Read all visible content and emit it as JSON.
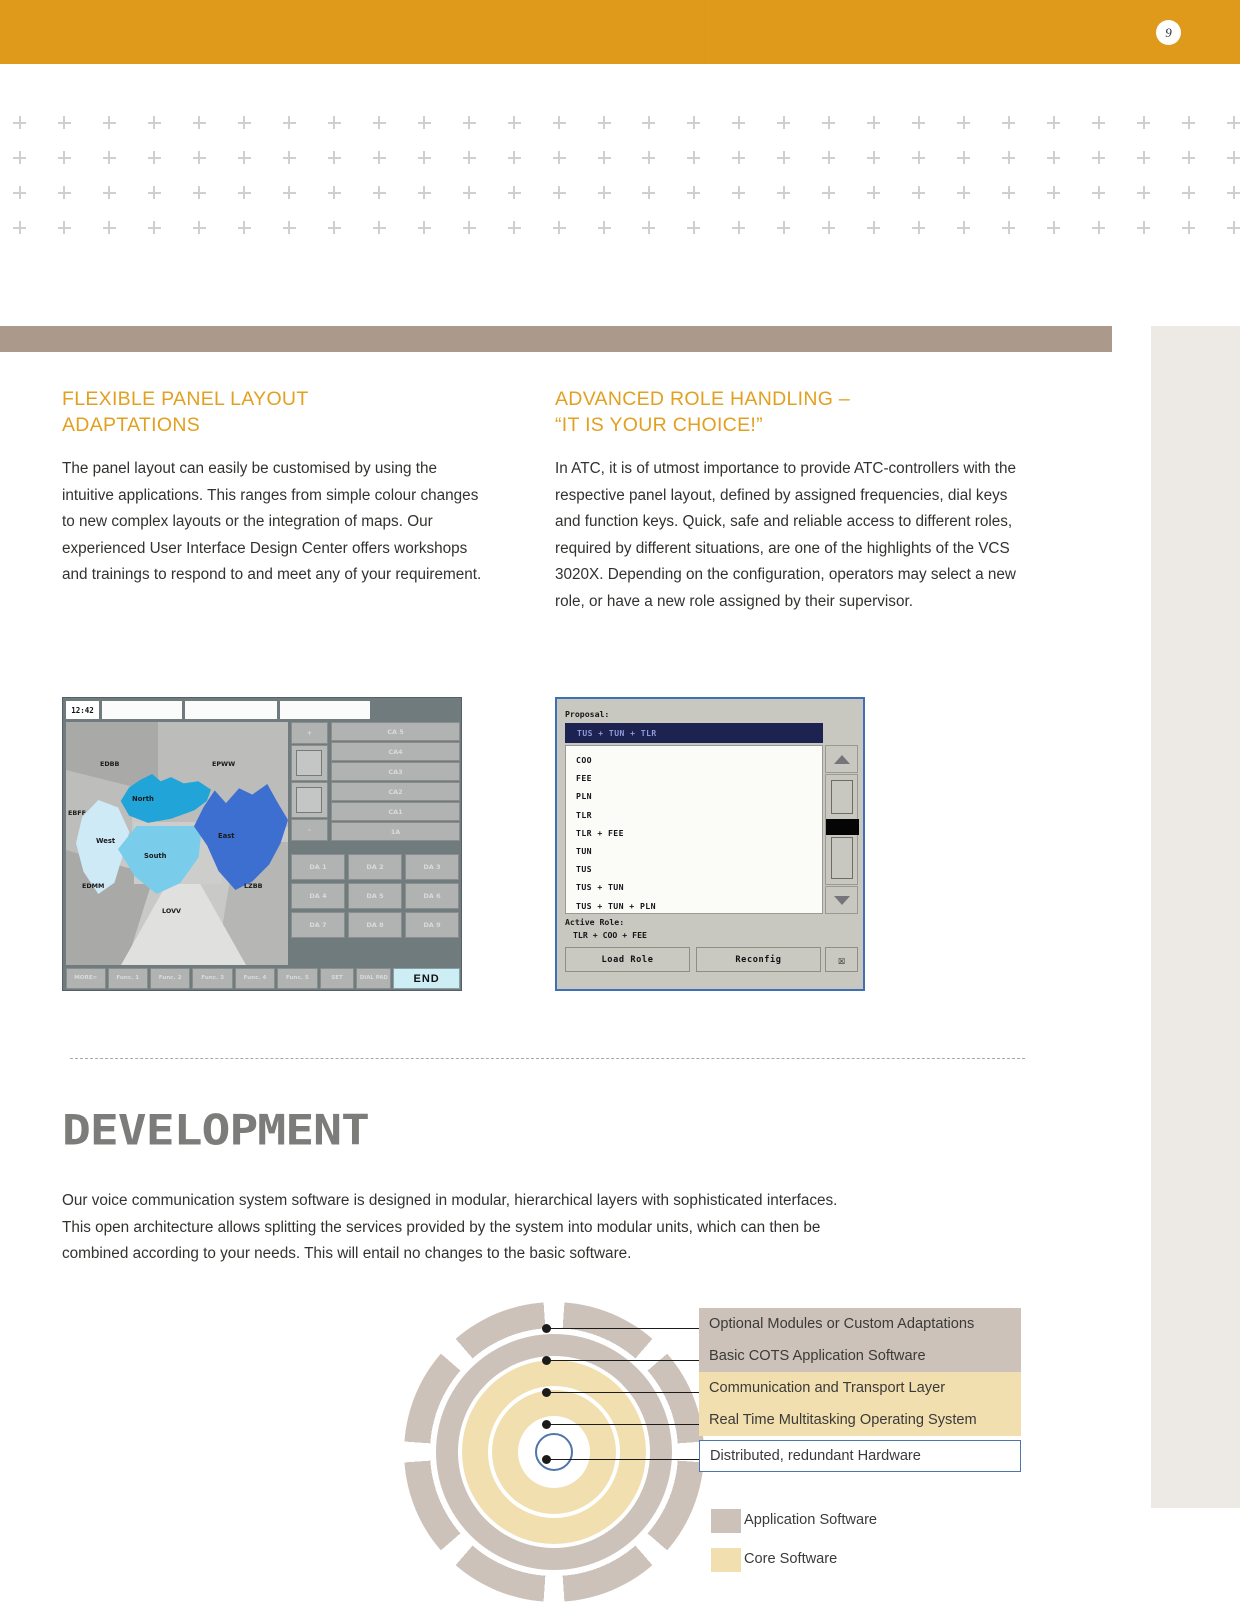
{
  "page": {
    "number": "9",
    "header_color": "#df9a1b",
    "accent_color": "#e2a020",
    "taupe_color": "#ab9a8b"
  },
  "columns": {
    "left": {
      "title": "FLEXIBLE PANEL LAYOUT\nADAPTATIONS",
      "body": "The panel layout can easily be customised by using the intuitive applications. This ranges from simple colour changes to new complex layouts or the integration of maps. Our experienced User Interface Design Center offers workshops and trainings to respond to and meet any of your requirement."
    },
    "right": {
      "title": "ADVANCED ROLE HANDLING –\n“IT IS YOUR CHOICE!”",
      "body": "In ATC, it is of utmost importance to provide ATC-controllers with the respective panel layout, defined by assigned frequencies, dial keys and function keys. Quick, safe and reliable access to different roles, required by different situations, are one of the highlights of the VCS 3020X. Depending on the configuration, operators may select a new role, or have a new role assigned by their supervisor."
    }
  },
  "map_panel": {
    "clock": "12:42",
    "sector_labels": [
      "EDBB",
      "EPWW",
      "EBFF",
      "EDMM",
      "LZBB",
      "LOVV"
    ],
    "country_regions": [
      "North",
      "West",
      "South",
      "East"
    ],
    "right_column_buttons": [
      "CA 5",
      "CA4",
      "CA3",
      "CA2",
      "CA1",
      "1A"
    ],
    "da_buttons": [
      "DA 1",
      "DA 2",
      "DA 3",
      "DA 4",
      "DA 5",
      "DA 6",
      "DA 7",
      "DA 8",
      "DA 9"
    ],
    "bottom_buttons": [
      "MORE>",
      "Func. 1",
      "Func. 2",
      "Func. 3",
      "Func. 4",
      "Func. 5",
      "SET"
    ],
    "dial_pad_label": "DIAL PAD",
    "end_button": "END"
  },
  "role_dialog": {
    "proposal_label": "Proposal:",
    "proposal_value": "TUS + TUN + TLR",
    "roles": [
      "COO",
      "FEE",
      "PLN",
      "TLR",
      "TLR + FEE",
      "TUN",
      "TUS",
      "TUS + TUN",
      "TUS + TUN + PLN"
    ],
    "active_role_label": "Active Role:",
    "active_role_value": "TLR + COO + FEE",
    "load_button": "Load Role",
    "reconfig_button": "Reconfig",
    "close_button": "☒"
  },
  "development": {
    "title": "DEVELOPMENT",
    "body": "Our voice communication system software is designed in modular, hierarchical layers with sophisticated interfaces. This open architecture allows splitting the services provided by the system into modular units, which can then be combined according to your needs. This will entail no changes to the basic software."
  },
  "diagram": {
    "layers": [
      {
        "label": "Optional Modules or Custom Adaptations",
        "group": "application",
        "color": "#cdc2b9"
      },
      {
        "label": "Basic COTS Application Software",
        "group": "application",
        "color": "#cdc2b9"
      },
      {
        "label": "Communication and Transport Layer",
        "group": "core",
        "color": "#f2dfaf"
      },
      {
        "label": "Real Time Multitasking Operating System",
        "group": "core",
        "color": "#f2dfaf"
      },
      {
        "label": "Distributed, redundant Hardware",
        "group": "hardware",
        "color": "#ffffff"
      }
    ],
    "legend": [
      {
        "label": "Application Software",
        "color": "#cdc2b9"
      },
      {
        "label": "Core Software",
        "color": "#f2dfaf"
      }
    ]
  }
}
